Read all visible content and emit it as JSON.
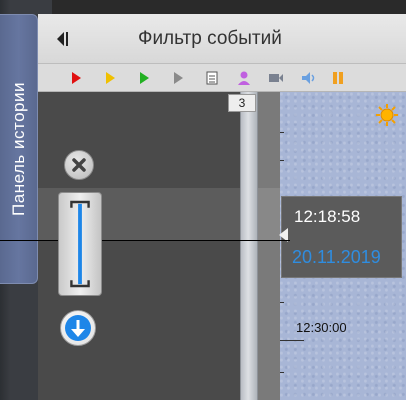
{
  "side_panel": {
    "history_tab_label": "Панель истории"
  },
  "header": {
    "title": "Фильтр событий"
  },
  "toolbar": {
    "icons": [
      "play-red-icon",
      "play-yellow-icon",
      "play-green-icon",
      "play-gray-icon",
      "document-icon",
      "user-icon",
      "camera-icon",
      "speaker-icon",
      "pause-orange-icon"
    ]
  },
  "timeline": {
    "event_count": "3",
    "tooltip_time": "12:18:58",
    "tooltip_date": "20.11.2019",
    "scale_time_label": "12:30:00"
  },
  "colors": {
    "accent_blue": "#2f8de0",
    "history_tab": "#6676a0",
    "events_background": "#a8b6d6"
  }
}
